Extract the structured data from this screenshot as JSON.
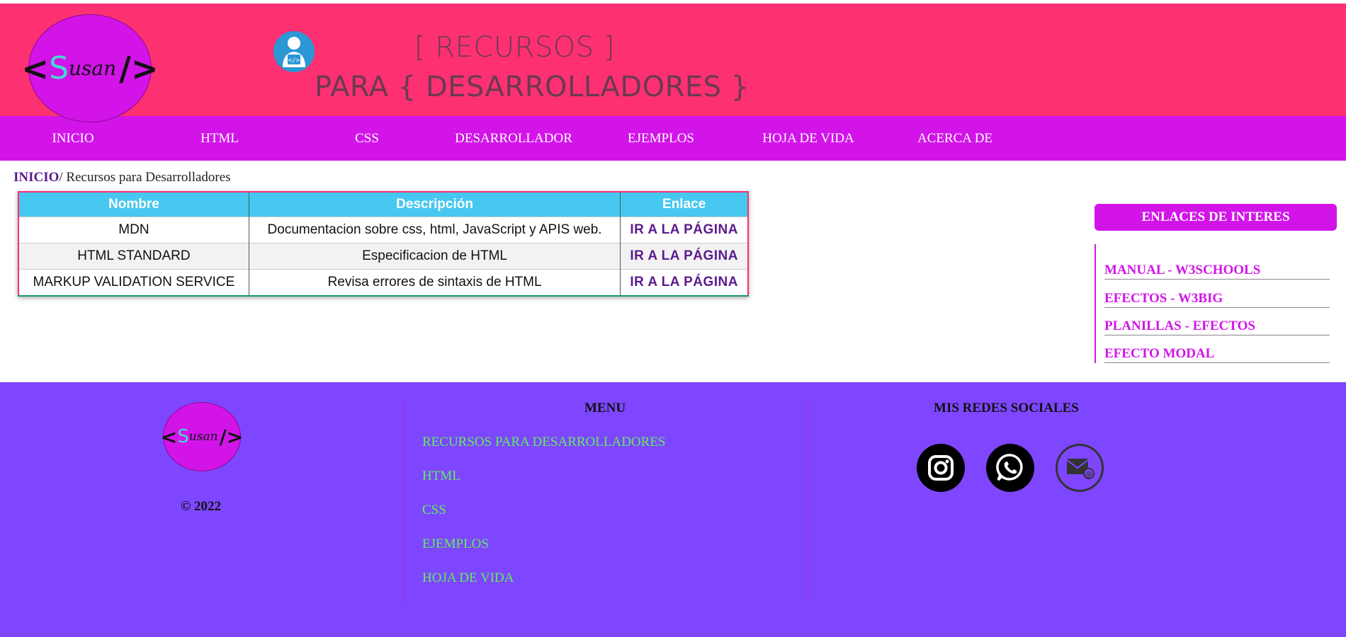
{
  "header": {
    "logo": {
      "open": "<",
      "s": "S",
      "rest": "usan",
      "close": "/>"
    },
    "title_line1": "[ RECURSOS ]",
    "title_line2": "PARA { DESARROLLADORES }",
    "icon": "developer-icon"
  },
  "nav": {
    "items": [
      "INICIO",
      "HTML",
      "CSS",
      "DESARROLLADOR",
      "EJEMPLOS",
      "HOJA DE VIDA",
      "ACERCA DE"
    ]
  },
  "breadcrumb": {
    "home": "INICIO",
    "current": "/ Recursos para Desarrolladores"
  },
  "table": {
    "headers": [
      "Nombre",
      "Descripción",
      "Enlace"
    ],
    "rows": [
      {
        "name": "MDN",
        "desc": "Documentacion sobre css, html, JavaScript y APIS web.",
        "link": "IR A LA PÁGINA"
      },
      {
        "name": "HTML STANDARD",
        "desc": "Especificacion de HTML",
        "link": "IR A LA PÁGINA"
      },
      {
        "name": "MARKUP VALIDATION SERVICE",
        "desc": "Revisa errores de sintaxis de HTML",
        "link": "IR A LA PÁGINA"
      }
    ]
  },
  "aside": {
    "title": "ENLACES DE INTERES",
    "links": [
      "MANUAL - W3SCHOOLS",
      "EFECTOS - W3BIG",
      "PLANILLAS - EFECTOS",
      "EFECTO MODAL"
    ]
  },
  "footer": {
    "copyright": "© 2022",
    "menu_title": "MENU",
    "menu_items": [
      "RECURSOS PARA DESARROLLADORES",
      "HTML",
      "CSS",
      "EJEMPLOS",
      "HOJA DE VIDA"
    ],
    "social_title": "MIS REDES SOCIALES",
    "social_icons": [
      "instagram-icon",
      "whatsapp-icon",
      "email-icon"
    ]
  },
  "colors": {
    "header_bg": "#fd3072",
    "nav_bg": "#d214e9",
    "footer_bg": "#7f46ff",
    "table_header": "#47c8f0",
    "footer_link": "#5cf05c"
  }
}
